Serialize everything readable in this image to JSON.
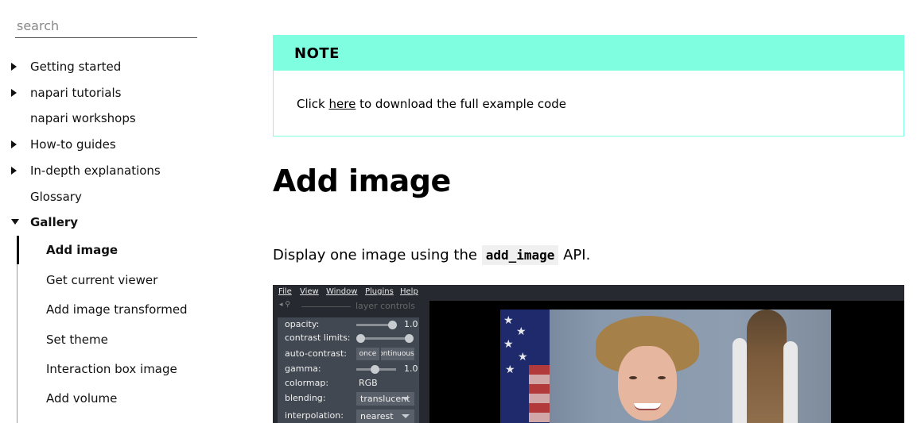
{
  "search": {
    "placeholder": "search"
  },
  "sidebar": {
    "items": [
      {
        "label": "Getting started",
        "expandable": true
      },
      {
        "label": "napari tutorials",
        "expandable": true
      },
      {
        "label": "napari workshops",
        "expandable": false
      },
      {
        "label": "How-to guides",
        "expandable": true
      },
      {
        "label": "In-depth explanations",
        "expandable": true
      },
      {
        "label": "Glossary",
        "expandable": false
      },
      {
        "label": "Gallery",
        "expandable": true,
        "expanded": true
      }
    ],
    "gallery_items": [
      {
        "label": "Add image",
        "active": true
      },
      {
        "label": "Get current viewer"
      },
      {
        "label": "Add image transformed"
      },
      {
        "label": "Set theme"
      },
      {
        "label": "Interaction box image"
      },
      {
        "label": "Add volume"
      }
    ]
  },
  "note": {
    "title": "NOTE",
    "text_before": "Click ",
    "link": "here",
    "text_after": " to download the full example code",
    "color": "#80ffe0"
  },
  "page": {
    "title": "Add image",
    "desc_before": "Display one image using the ",
    "desc_code": "add_image",
    "desc_after": " API."
  },
  "viewer": {
    "menu": [
      "File",
      "View",
      "Window",
      "Plugins",
      "Help"
    ],
    "layer_controls_label": "layer controls",
    "controls": {
      "opacity_label": "opacity:",
      "opacity_value": "1.0",
      "contrast_label": "contrast limits:",
      "auto_contrast_label": "auto-contrast:",
      "once_label": "once",
      "continuous_label": "continuous",
      "gamma_label": "gamma:",
      "gamma_value": "1.0",
      "colormap_label": "colormap:",
      "colormap_value": "RGB",
      "blending_label": "blending:",
      "blending_value": "translucent",
      "interpolation_label": "interpolation:",
      "interpolation_value": "nearest"
    },
    "background": "#262930",
    "panel_color": "#414851"
  }
}
